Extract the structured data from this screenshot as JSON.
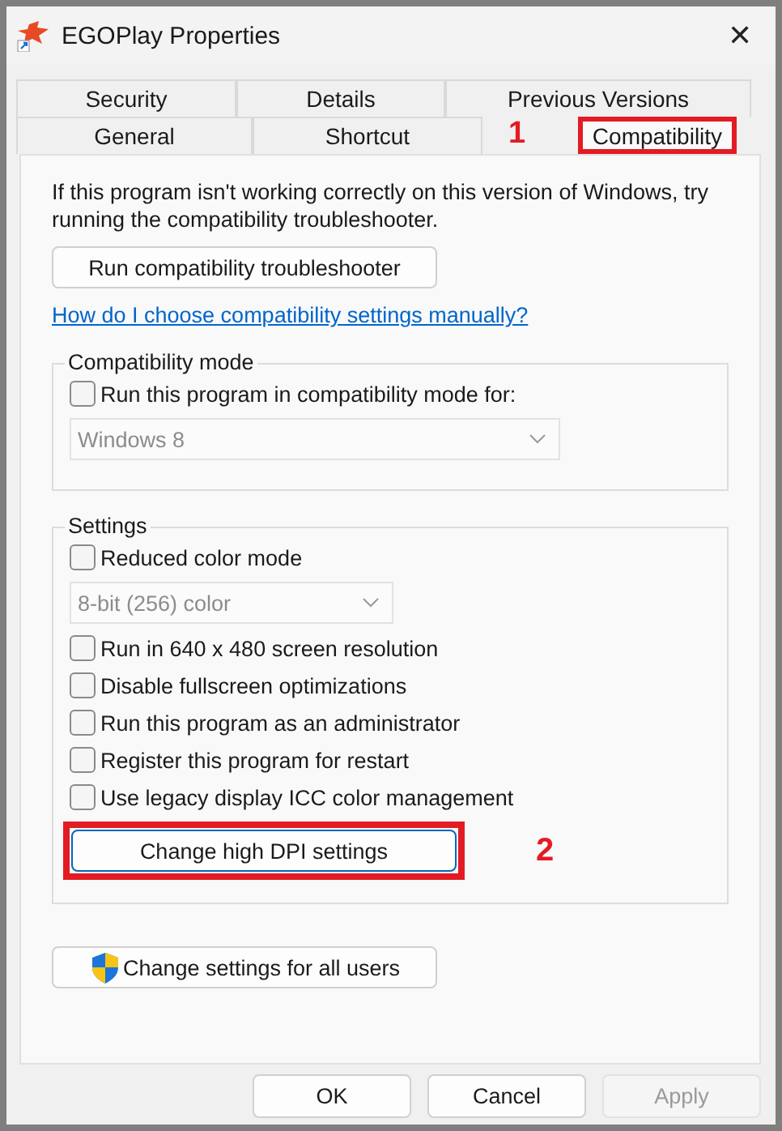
{
  "window": {
    "title": "EGOPlay Properties",
    "close": "✕"
  },
  "tab_rows": [
    [
      {
        "label": "Security",
        "selected": false
      },
      {
        "label": "Details",
        "selected": false
      },
      {
        "label": "Previous Versions",
        "selected": false
      }
    ],
    [
      {
        "label": "General",
        "selected": false
      },
      {
        "label": "Shortcut",
        "selected": false
      },
      {
        "label": "Compatibility",
        "selected": true,
        "annotation": "1"
      }
    ]
  ],
  "intro": "If this program isn't working correctly on this version of Windows, try running the compatibility troubleshooter.",
  "troubleshooter_button": "Run compatibility troubleshooter",
  "help_link": "How do I choose compatibility settings manually?",
  "compatibility_mode": {
    "title": "Compatibility mode",
    "items": [
      {
        "kind": "checkbox",
        "label": "Run this program in compatibility mode for:",
        "checked": false
      },
      {
        "kind": "dropdown",
        "value": "Windows 8",
        "disabled": true
      }
    ]
  },
  "settings": {
    "title": "Settings",
    "items": [
      {
        "kind": "checkbox",
        "label": "Reduced color mode",
        "checked": false
      },
      {
        "kind": "dropdown",
        "value": "8-bit (256) color",
        "disabled": true
      },
      {
        "kind": "checkbox",
        "label": "Run in 640 x 480 screen resolution",
        "checked": false
      },
      {
        "kind": "checkbox",
        "label": "Disable fullscreen optimizations",
        "checked": false
      },
      {
        "kind": "checkbox",
        "label": "Run this program as an administrator",
        "checked": false
      },
      {
        "kind": "checkbox",
        "label": "Register this program for restart",
        "checked": false
      },
      {
        "kind": "checkbox",
        "label": "Use legacy display ICC color management",
        "checked": false
      },
      {
        "kind": "button",
        "label": "Change high DPI settings",
        "annotation": "2"
      }
    ]
  },
  "all_users_button": "Change settings for all users",
  "buttons": [
    {
      "label": "OK",
      "disabled": false
    },
    {
      "label": "Cancel",
      "disabled": false
    },
    {
      "label": "Apply",
      "disabled": true
    }
  ]
}
